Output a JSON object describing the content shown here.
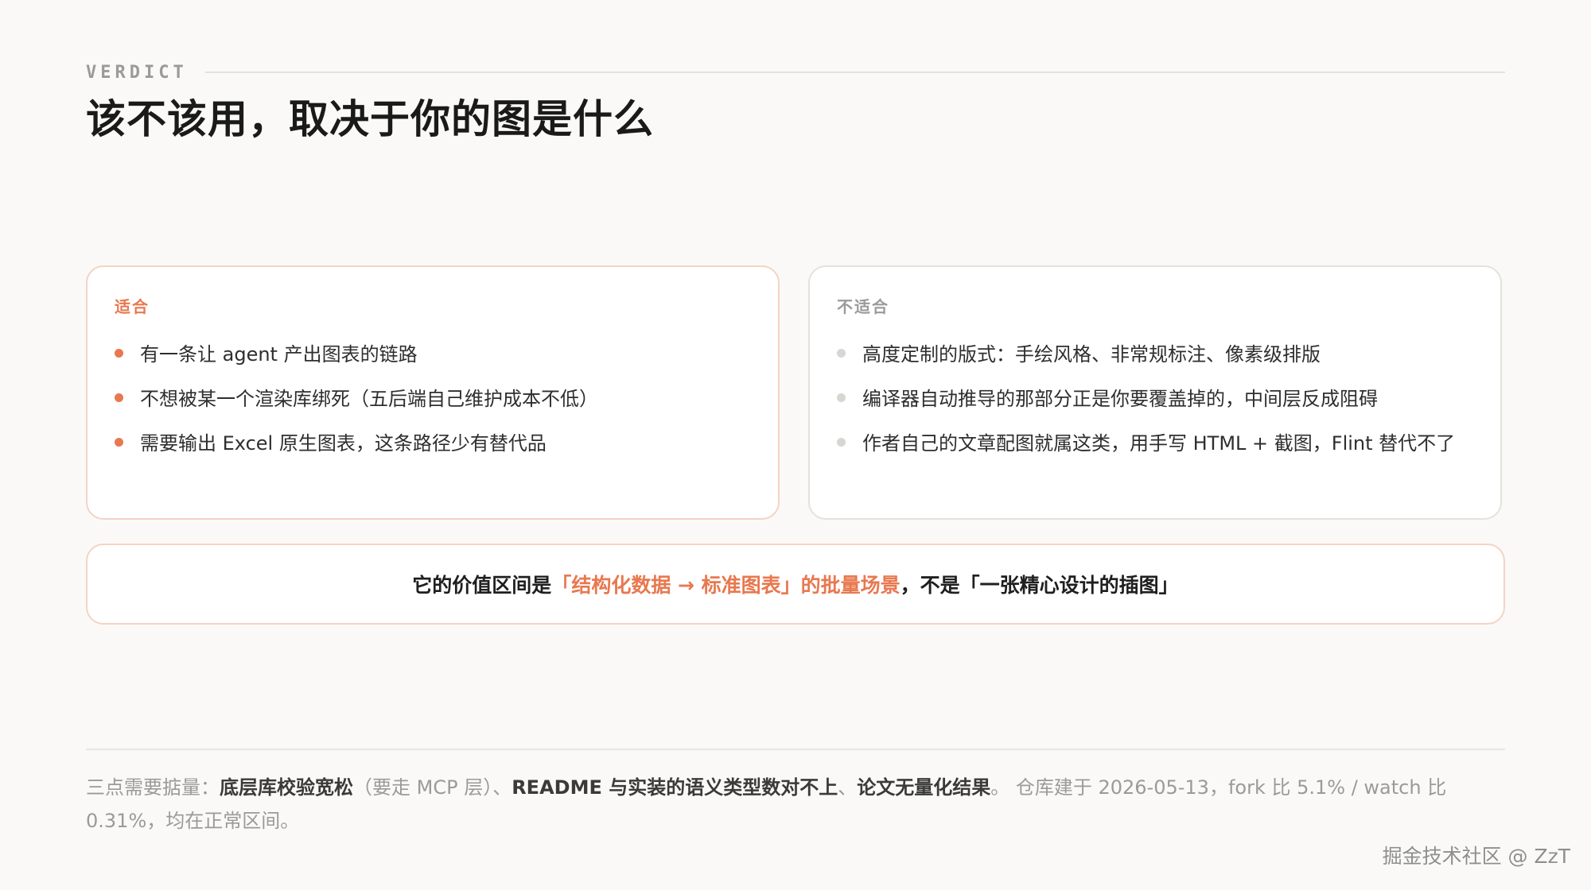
{
  "header": {
    "eyebrow": "VERDICT",
    "title": "该不该用，取决于你的图是什么"
  },
  "fit_card": {
    "label": "适合",
    "items": [
      "有一条让 agent 产出图表的链路",
      "不想被某一个渲染库绑死（五后端自己维护成本不低）",
      "需要输出 Excel 原生图表，这条路径少有替代品"
    ]
  },
  "unfit_card": {
    "label": "不适合",
    "items": [
      "高度定制的版式：手绘风格、非常规标注、像素级排版",
      "编译器自动推导的那部分正是你要覆盖掉的，中间层反成阻碍",
      "作者自己的文章配图就属这类，用手写 HTML + 截图，Flint 替代不了"
    ]
  },
  "summary": {
    "prefix": "它的价值区间是",
    "highlight": "「结构化数据 → 标准图表」的批量场景",
    "suffix": "，不是「一张精心设计的插图」"
  },
  "footnote": {
    "lead": "三点需要掂量：",
    "point1": "底层库校验宽松",
    "point1_note": "（要走 MCP 层）、",
    "point2": "README 与实装的语义类型数对不上",
    "sep": "、",
    "point3": "论文无量化结果",
    "tail": "。 仓库建于 2026-05-13，fork 比 5.1% / watch 比 0.31%，均在正常区间。"
  },
  "watermark": "掘金技术社区 @ ZzT",
  "colors": {
    "accent": "#e8784f",
    "muted": "#9a9a9a",
    "background": "#faf9f7"
  }
}
